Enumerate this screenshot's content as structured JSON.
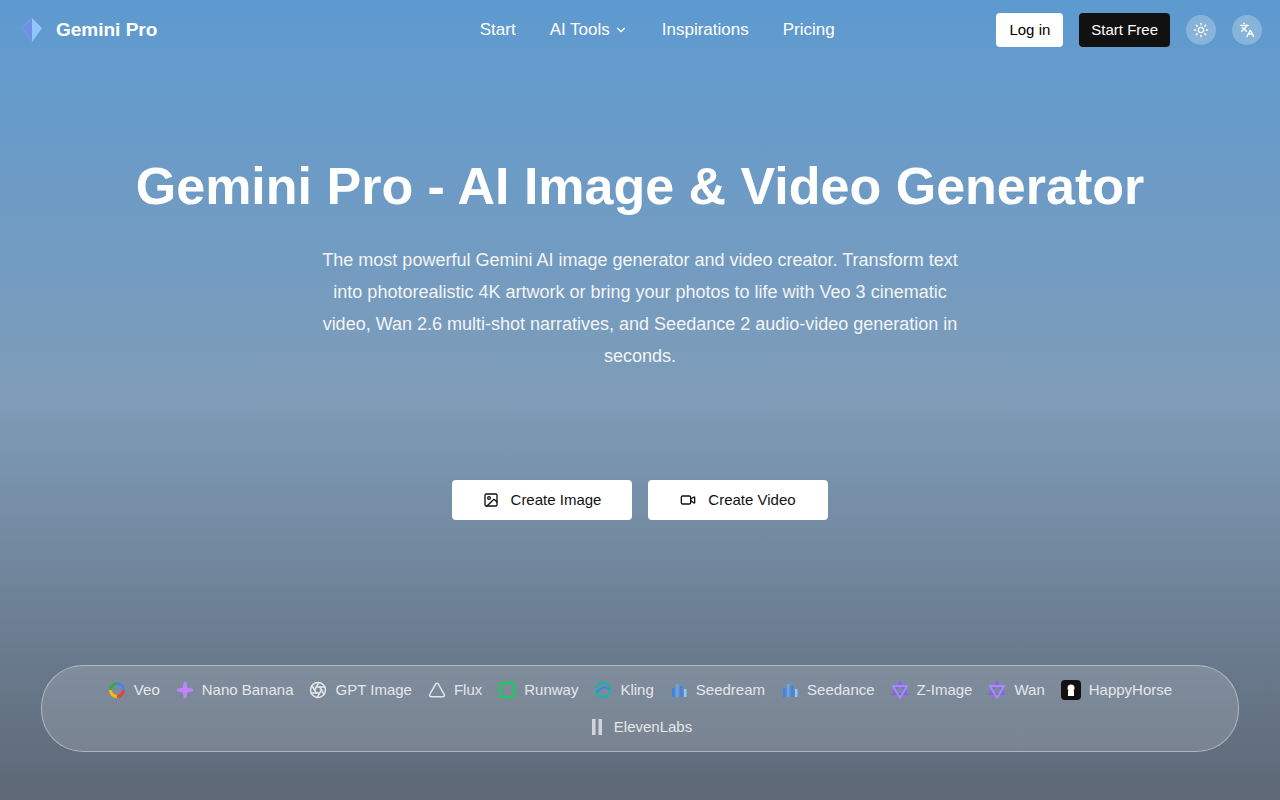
{
  "brand": {
    "name": "Gemini Pro"
  },
  "nav": {
    "links": [
      {
        "label": "Start",
        "dropdown": false
      },
      {
        "label": "AI Tools",
        "dropdown": true
      },
      {
        "label": "Inspirations",
        "dropdown": false
      },
      {
        "label": "Pricing",
        "dropdown": false
      }
    ],
    "login": "Log in",
    "start_free": "Start Free"
  },
  "hero": {
    "title": "Gemini Pro - AI Image & Video Generator",
    "subtitle": "The most powerful Gemini AI image generator and video creator. Transform text into photorealistic 4K artwork or bring your photos to life with Veo 3 cinematic video, Wan 2.6 multi-shot narratives, and Seedance 2 audio-video generation in seconds.",
    "buttons": [
      "Create Image",
      "Create Video"
    ]
  },
  "models": [
    "Veo",
    "Nano Banana",
    "GPT Image",
    "Flux",
    "Runway",
    "Kling",
    "Seedream",
    "Seedance",
    "Z-Image",
    "Wan",
    "HappyHorse",
    "ElevenLabs"
  ]
}
